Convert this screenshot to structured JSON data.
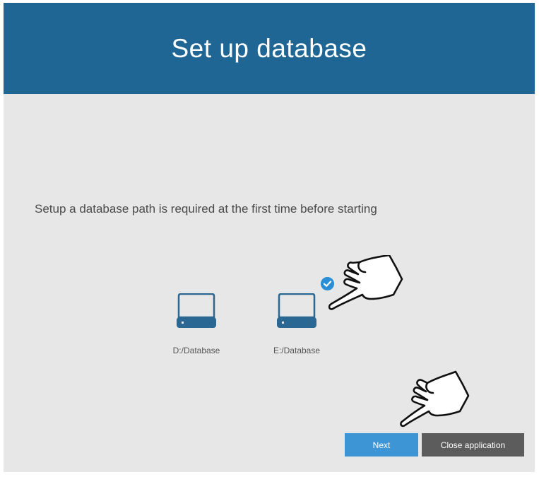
{
  "header": {
    "title": "Set up database"
  },
  "main": {
    "instruction": "Setup a database path is required at the first time before starting",
    "drives": [
      {
        "label": "D:/Database",
        "selected": false,
        "icon": "drive-icon"
      },
      {
        "label": "E:/Database",
        "selected": true,
        "icon": "drive-icon"
      }
    ]
  },
  "actions": {
    "next_label": "Next",
    "close_label": "Close application"
  },
  "colors": {
    "header": "#1f6694",
    "background": "#e7e7e7",
    "accent": "#3d95d5",
    "secondary_button": "#5c5c5c",
    "check": "#2a8ed6"
  },
  "icons": {
    "selected": "check-circle-icon",
    "pointer": "pointing-hand-icon"
  }
}
